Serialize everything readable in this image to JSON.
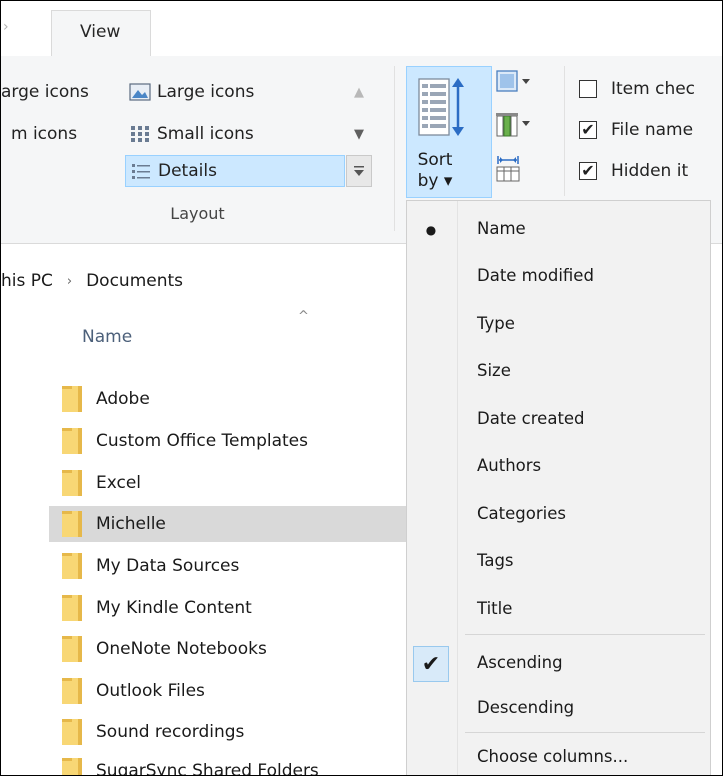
{
  "tabs": {
    "view": "View"
  },
  "ribbon": {
    "layout": {
      "items": {
        "large_icons_left": "arge icons",
        "large_icons": "Large icons",
        "medium_icons": "m icons",
        "small_icons": "Small icons",
        "details": "Details"
      },
      "group_label": "Layout"
    },
    "sort_by": "Sort by ▾",
    "show_hide": {
      "item_check_boxes": {
        "label": "Item chec",
        "checked": false
      },
      "file_name_extensions": {
        "label": "File name",
        "checked": true
      },
      "hidden_items": {
        "label": "Hidden it",
        "checked": true
      }
    }
  },
  "address": {
    "segments": [
      "his PC",
      "Documents"
    ],
    "separator": "›"
  },
  "file_list": {
    "column_name": "Name",
    "sort_indicator": "^",
    "items": [
      "Adobe",
      "Custom Office Templates",
      "Excel",
      "Michelle",
      "My Data Sources",
      "My Kindle Content",
      "OneNote Notebooks",
      "Outlook Files",
      "Sound recordings",
      "SugarSync Shared Folders"
    ],
    "selected": "Michelle"
  },
  "sort_menu": {
    "fields": [
      "Name",
      "Date modified",
      "Type",
      "Size",
      "Date created",
      "Authors",
      "Categories",
      "Tags",
      "Title"
    ],
    "active_field": "Name",
    "bullet": "●",
    "directions": [
      "Ascending",
      "Descending"
    ],
    "active_direction": "Ascending",
    "check": "✔",
    "choose_columns": "Choose columns..."
  },
  "colors": {
    "accent_light": "#cce8ff",
    "accent_border": "#99d1ff",
    "selected_row": "#d9d9d9",
    "folder": "#f8d775"
  }
}
